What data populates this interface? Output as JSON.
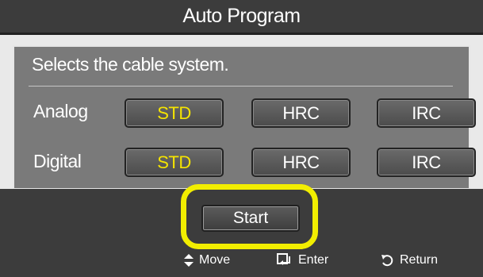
{
  "window": {
    "title": "Auto Program"
  },
  "panel": {
    "subtitle": "Selects the cable system.",
    "rows": [
      {
        "label": "Analog",
        "options": [
          "STD",
          "HRC",
          "IRC"
        ],
        "selected": "STD"
      },
      {
        "label": "Digital",
        "options": [
          "STD",
          "HRC",
          "IRC"
        ],
        "selected": "STD"
      }
    ]
  },
  "start_label": "Start",
  "footer": {
    "move": {
      "icon": "up-down-arrows-icon",
      "label": "Move"
    },
    "enter": {
      "icon": "enter-icon",
      "label": "Enter"
    },
    "return": {
      "icon": "return-icon",
      "label": "Return"
    }
  },
  "colors": {
    "selected_text": "#f5e400",
    "highlight_ring": "#f2ee00",
    "panel_bg": "#7a7a7a",
    "title_bg": "#3c3c3c"
  }
}
